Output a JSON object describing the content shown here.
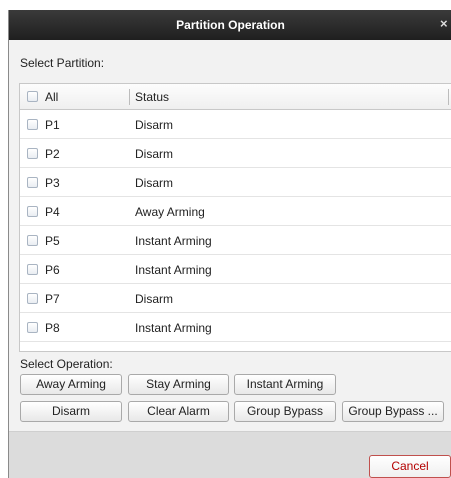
{
  "dialog": {
    "title": "Partition Operation",
    "close_glyph": "×",
    "select_partition_label": "Select Partition:",
    "select_operation_label": "Select Operation:"
  },
  "table": {
    "headers": {
      "all": "All",
      "status": "Status"
    },
    "rows": [
      {
        "name": "P1",
        "status": "Disarm"
      },
      {
        "name": "P2",
        "status": "Disarm"
      },
      {
        "name": "P3",
        "status": "Disarm"
      },
      {
        "name": "P4",
        "status": "Away Arming"
      },
      {
        "name": "P5",
        "status": "Instant Arming"
      },
      {
        "name": "P6",
        "status": "Instant Arming"
      },
      {
        "name": "P7",
        "status": "Disarm"
      },
      {
        "name": "P8",
        "status": "Instant Arming"
      }
    ]
  },
  "operations": {
    "away_arming": "Away Arming",
    "stay_arming": "Stay Arming",
    "instant_arming": "Instant Arming",
    "disarm": "Disarm",
    "clear_alarm": "Clear Alarm",
    "group_bypass": "Group Bypass",
    "group_bypass_more": "Group Bypass ..."
  },
  "footer": {
    "cancel_label": "Cancel"
  },
  "colors": {
    "titlebar": "#2a2a2a",
    "cancel_text": "#b40000",
    "footer_bg": "#dcdcdc"
  }
}
